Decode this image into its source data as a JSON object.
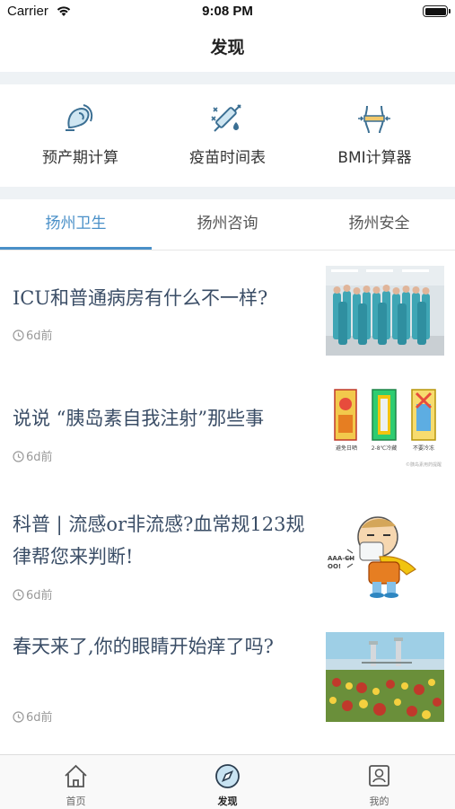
{
  "status_bar": {
    "carrier": "Carrier",
    "time": "9:08 PM"
  },
  "nav": {
    "title": "发现"
  },
  "tools": [
    {
      "label": "预产期计算",
      "icon": "pregnancy-icon"
    },
    {
      "label": "疫苗时间表",
      "icon": "vaccine-syringe-icon"
    },
    {
      "label": "BMI计算器",
      "icon": "waist-measure-icon"
    }
  ],
  "tabs": [
    {
      "label": "扬州卫生",
      "active": true
    },
    {
      "label": "扬州咨询",
      "active": false
    },
    {
      "label": "扬州安全",
      "active": false
    }
  ],
  "news": [
    {
      "title": "ICU和普通病房有什么不一样?",
      "time": "6d前"
    },
    {
      "title": "说说 “胰岛素自我注射”那些事",
      "time": "6d前"
    },
    {
      "title": "科普 | 流感or非流感?血常规123规律帮您来判断!",
      "time": "6d前"
    },
    {
      "title": "春天来了,你的眼睛开始痒了吗?",
      "time": "6d前"
    }
  ],
  "thumbs": {
    "insulin_captions": [
      "避免日晒",
      "2-8℃冷藏",
      "不要冷冻"
    ],
    "insulin_source": "©胰岛素用药提醒",
    "sneeze_text": "AAA-CHOO!"
  },
  "tabbar": [
    {
      "label": "首页",
      "icon": "home-icon",
      "active": false
    },
    {
      "label": "发现",
      "icon": "discover-compass-icon",
      "active": true
    },
    {
      "label": "我的",
      "icon": "profile-icon",
      "active": false
    }
  ],
  "colors": {
    "accent": "#4a90c8",
    "title_text": "#3a4d66",
    "divider": "#eef2f5"
  }
}
